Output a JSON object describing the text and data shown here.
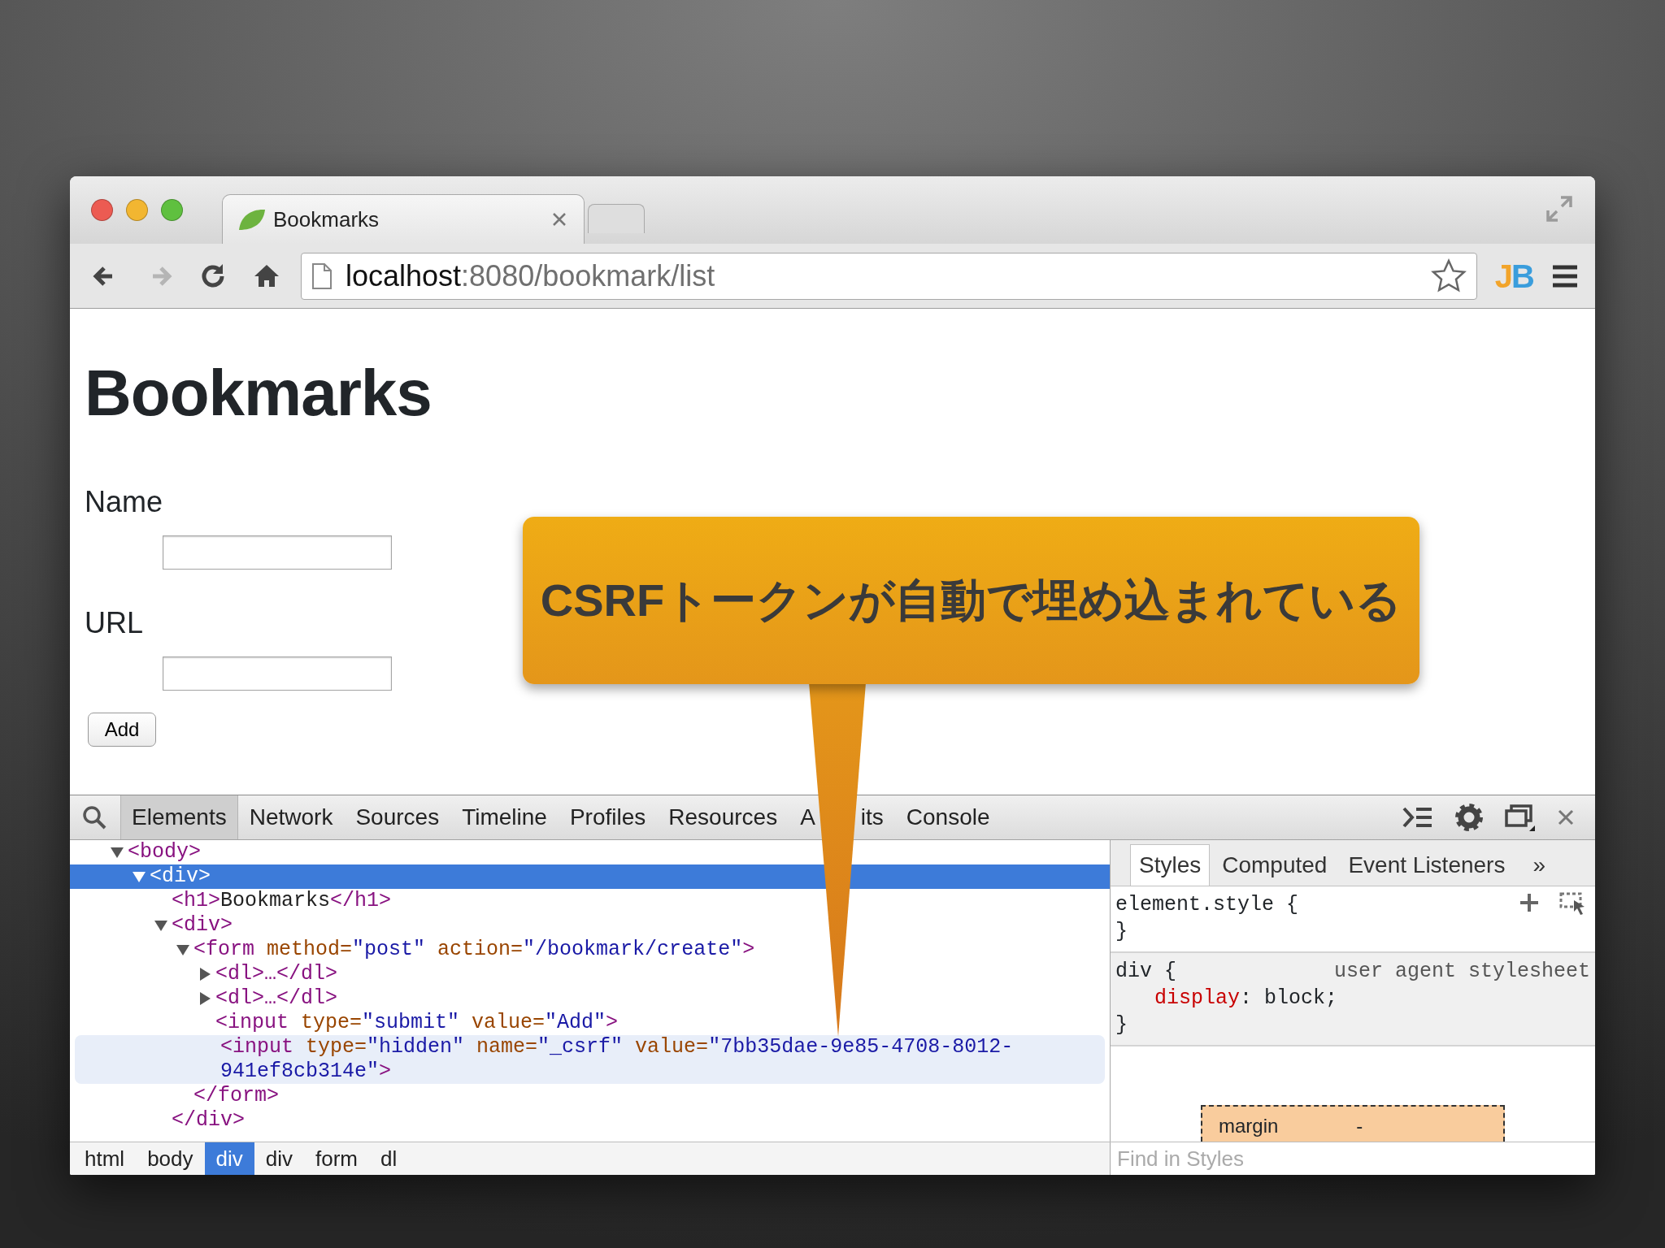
{
  "browser": {
    "tab": {
      "title": "Bookmarks"
    },
    "nav_buttons": [
      {
        "kind": "back",
        "disabled": false
      },
      {
        "kind": "forward",
        "disabled": true
      },
      {
        "kind": "reload",
        "disabled": false
      },
      {
        "kind": "home",
        "disabled": false
      }
    ],
    "address": {
      "host": "localhost",
      "path": ":8080/bookmark/list"
    },
    "extension": {
      "letters": [
        {
          "text": "J",
          "color": "#f2a42a"
        },
        {
          "text": "B",
          "color": "#3a9ddc"
        }
      ]
    }
  },
  "page": {
    "heading": "Bookmarks",
    "fields": [
      {
        "label": "Name"
      },
      {
        "label": "URL"
      }
    ],
    "button": "Add"
  },
  "devtools": {
    "tabs": [
      {
        "label": "Elements",
        "selected": true
      },
      {
        "label": "Network",
        "selected": false
      },
      {
        "label": "Sources",
        "selected": false
      },
      {
        "label": "Timeline",
        "selected": false
      },
      {
        "label": "Profiles",
        "selected": false
      },
      {
        "label": "Resources",
        "selected": false
      },
      {
        "visible_parts": [
          "A",
          "its"
        ],
        "selected": false
      },
      {
        "label": "Console",
        "selected": false
      }
    ],
    "tree": [
      {
        "parts": [
          {
            "kind": "tag",
            "text": "<body>"
          }
        ],
        "expanded": true,
        "selected": false,
        "hovered": false,
        "children": [
          {
            "parts": [
              {
                "kind": "tag",
                "text": "<div>"
              }
            ],
            "expanded": true,
            "selected": true,
            "hovered": false,
            "children": [
              {
                "parts": [
                  {
                    "kind": "tag",
                    "text": "<h1>"
                  },
                  {
                    "kind": "text",
                    "text": "Bookmarks"
                  },
                  {
                    "kind": "tag",
                    "text": "</h1>"
                  }
                ],
                "selected": false,
                "hovered": false
              },
              {
                "parts": [
                  {
                    "kind": "tag",
                    "text": "<div>"
                  }
                ],
                "expanded": true,
                "selected": false,
                "hovered": false,
                "closing": "</div>",
                "children": [
                  {
                    "parts": [
                      {
                        "kind": "tag",
                        "text": "<form"
                      },
                      {
                        "kind": "attr",
                        "text": " method="
                      },
                      {
                        "kind": "val",
                        "text": "\"post\""
                      },
                      {
                        "kind": "attr",
                        "text": " action="
                      },
                      {
                        "kind": "val",
                        "text": "\"/bookmark/create\""
                      },
                      {
                        "kind": "tag",
                        "text": ">"
                      }
                    ],
                    "expanded": true,
                    "selected": false,
                    "hovered": false,
                    "closing": "</form>",
                    "children": [
                      {
                        "parts": [
                          {
                            "kind": "tag",
                            "text": "<dl>…</dl>"
                          }
                        ],
                        "expanded": false,
                        "selected": false,
                        "hovered": false
                      },
                      {
                        "parts": [
                          {
                            "kind": "tag",
                            "text": "<dl>…</dl>"
                          }
                        ],
                        "expanded": false,
                        "selected": false,
                        "hovered": false
                      },
                      {
                        "parts": [
                          {
                            "kind": "tag",
                            "text": "<input"
                          },
                          {
                            "kind": "attr",
                            "text": " type="
                          },
                          {
                            "kind": "val",
                            "text": "\"submit\""
                          },
                          {
                            "kind": "attr",
                            "text": " value="
                          },
                          {
                            "kind": "val",
                            "text": "\"Add\""
                          },
                          {
                            "kind": "tag",
                            "text": ">"
                          }
                        ],
                        "selected": false,
                        "hovered": false
                      },
                      {
                        "parts": [
                          {
                            "kind": "tag",
                            "text": "<input"
                          },
                          {
                            "kind": "attr",
                            "text": " type="
                          },
                          {
                            "kind": "val",
                            "text": "\"hidden\""
                          },
                          {
                            "kind": "attr",
                            "text": " name="
                          },
                          {
                            "kind": "val",
                            "text": "\"_csrf\""
                          },
                          {
                            "kind": "attr",
                            "text": " value="
                          },
                          {
                            "kind": "val",
                            "text": "\"7bb35dae-9e85-4708-8012-941ef8cb314e\""
                          },
                          {
                            "kind": "tag",
                            "text": ">"
                          }
                        ],
                        "selected": false,
                        "hovered": true
                      }
                    ]
                  }
                ]
              }
            ]
          }
        ]
      }
    ],
    "sidebar_tabs": [
      {
        "label": "Styles",
        "selected": true
      },
      {
        "label": "Computed",
        "selected": false
      },
      {
        "label": "Event Listeners",
        "selected": false
      }
    ],
    "sidebar_more": "»",
    "rules": [
      {
        "kind": "inline",
        "header": "element.style {",
        "closing": "}"
      },
      {
        "kind": "user-agent",
        "header": "div {",
        "source": "user agent stylesheet",
        "declarations": [
          {
            "property": "display",
            "value": ": block;"
          }
        ],
        "closing": "}"
      }
    ],
    "box_model": {
      "label": "margin",
      "value": "-"
    },
    "find": {
      "placeholder": "Find in Styles"
    },
    "breadcrumbs": [
      {
        "label": "html",
        "selected": false
      },
      {
        "label": "body",
        "selected": false
      },
      {
        "label": "div",
        "selected": true
      },
      {
        "label": "div",
        "selected": false
      },
      {
        "label": "form",
        "selected": false
      },
      {
        "label": "dl",
        "selected": false
      }
    ]
  },
  "callout": {
    "text": "CSRFトークンが自動で埋め込まれている"
  }
}
